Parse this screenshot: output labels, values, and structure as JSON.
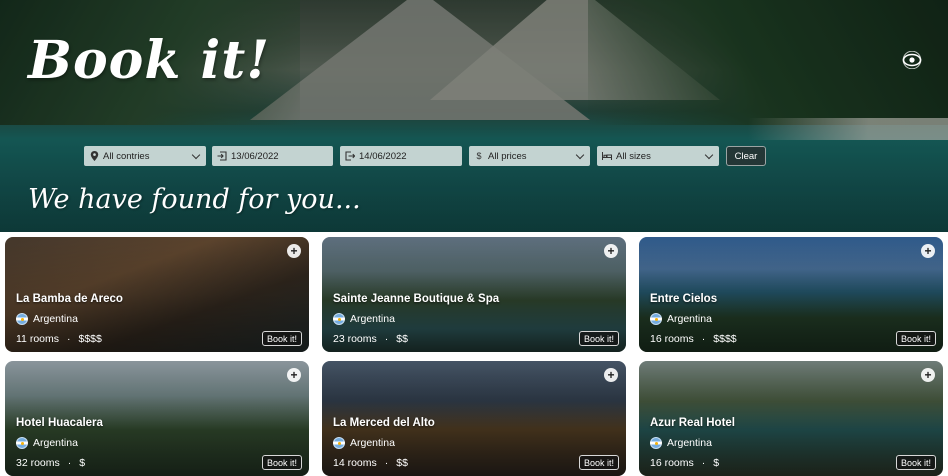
{
  "brand": {
    "logo_text": "Book it!"
  },
  "hero": {
    "subtitle": "We have found for you..."
  },
  "filters": {
    "country": "All contries",
    "checkin": "13/06/2022",
    "checkout": "14/06/2022",
    "price": "All prices",
    "size": "All sizes",
    "clear_label": "Clear"
  },
  "icons": {
    "visibility": "eye-icon",
    "location": "map-pin-icon",
    "checkin": "login-icon",
    "checkout": "logout-icon",
    "price": "dollar-icon",
    "size": "bed-icon",
    "add": "plus-icon"
  },
  "hotels": [
    {
      "name": "La Bamba de Areco",
      "country": "Argentina",
      "rooms": "11 rooms",
      "price": "$$$$",
      "book_label": "Book it!",
      "add_label": "+"
    },
    {
      "name": "Sainte Jeanne Boutique & Spa",
      "country": "Argentina",
      "rooms": "23 rooms",
      "price": "$$",
      "book_label": "Book it!",
      "add_label": "+"
    },
    {
      "name": "Entre Cielos",
      "country": "Argentina",
      "rooms": "16 rooms",
      "price": "$$$$",
      "book_label": "Book it!",
      "add_label": "+"
    },
    {
      "name": "Hotel Huacalera",
      "country": "Argentina",
      "rooms": "32 rooms",
      "price": "$",
      "book_label": "Book it!",
      "add_label": "+"
    },
    {
      "name": "La Merced del Alto",
      "country": "Argentina",
      "rooms": "14 rooms",
      "price": "$$",
      "book_label": "Book it!",
      "add_label": "+"
    },
    {
      "name": "Azur Real Hotel",
      "country": "Argentina",
      "rooms": "16 rooms",
      "price": "$",
      "book_label": "Book it!",
      "add_label": "+"
    }
  ],
  "colors": {
    "lake": "#1e7f7a",
    "filter_bg": "#d2dedc",
    "card_overlay": "#000000"
  }
}
